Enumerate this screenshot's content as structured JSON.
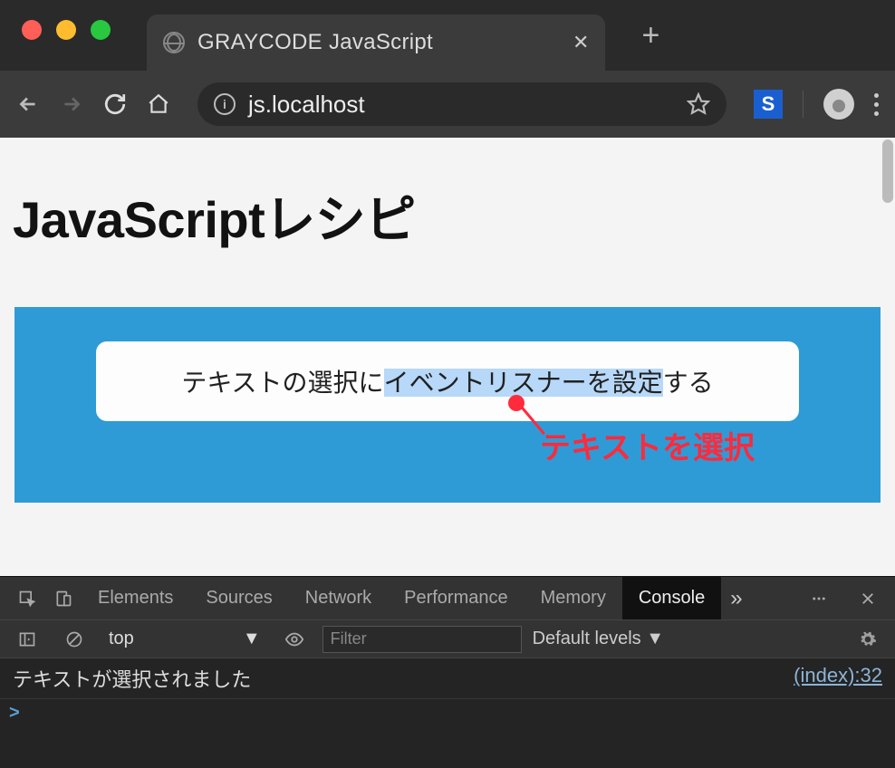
{
  "window": {
    "tab_title": "GRAYCODE JavaScript",
    "url": "js.localhost"
  },
  "page": {
    "heading": "JavaScriptレシピ",
    "sample_text_pre": "テキストの選択に",
    "sample_text_selected": "イベントリスナーを設定",
    "sample_text_post": "する",
    "callout": "テキストを選択"
  },
  "devtools": {
    "tabs": {
      "elements": "Elements",
      "sources": "Sources",
      "network": "Network",
      "performance": "Performance",
      "memory": "Memory",
      "console": "Console"
    },
    "more": "»",
    "context": "top",
    "filter_placeholder": "Filter",
    "levels": "Default levels ▼",
    "log_message": "テキストが選択されました",
    "log_source": "(index):32",
    "prompt": ">"
  }
}
